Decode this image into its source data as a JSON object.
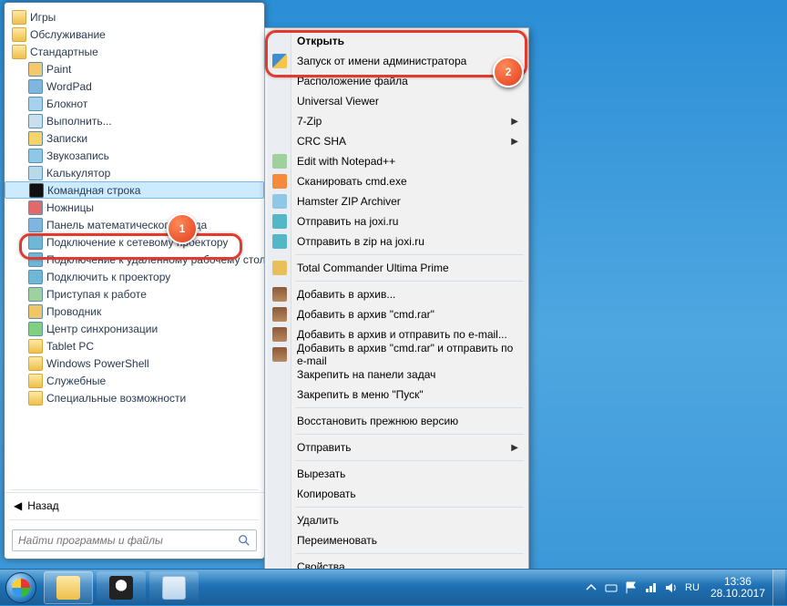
{
  "start_menu": {
    "items": [
      {
        "label": "Игры",
        "type": "folder",
        "indent": 0
      },
      {
        "label": "Обслуживание",
        "type": "folder",
        "indent": 0
      },
      {
        "label": "Стандартные",
        "type": "folder",
        "indent": 0,
        "expanded": true
      },
      {
        "label": "Paint",
        "type": "app",
        "indent": 1,
        "icon": "paint"
      },
      {
        "label": "WordPad",
        "type": "app",
        "indent": 1,
        "icon": "wordpad"
      },
      {
        "label": "Блокнот",
        "type": "app",
        "indent": 1,
        "icon": "notepad"
      },
      {
        "label": "Выполнить...",
        "type": "app",
        "indent": 1,
        "icon": "run"
      },
      {
        "label": "Записки",
        "type": "app",
        "indent": 1,
        "icon": "notes"
      },
      {
        "label": "Звукозапись",
        "type": "app",
        "indent": 1,
        "icon": "sound"
      },
      {
        "label": "Калькулятор",
        "type": "app",
        "indent": 1,
        "icon": "calc"
      },
      {
        "label": "Командная строка",
        "type": "app",
        "indent": 1,
        "icon": "cmd",
        "selected": true
      },
      {
        "label": "Ножницы",
        "type": "app",
        "indent": 1,
        "icon": "snip"
      },
      {
        "label": "Панель математического ввода",
        "type": "app",
        "indent": 1,
        "icon": "math"
      },
      {
        "label": "Подключение к сетевому проектору",
        "type": "app",
        "indent": 1,
        "icon": "netproj"
      },
      {
        "label": "Подключение к удаленному рабочему столу",
        "type": "app",
        "indent": 1,
        "icon": "rdp"
      },
      {
        "label": "Подключить к проектору",
        "type": "app",
        "indent": 1,
        "icon": "proj"
      },
      {
        "label": "Приступая к работе",
        "type": "app",
        "indent": 1,
        "icon": "welcome"
      },
      {
        "label": "Проводник",
        "type": "app",
        "indent": 1,
        "icon": "explorer"
      },
      {
        "label": "Центр синхронизации",
        "type": "app",
        "indent": 1,
        "icon": "sync"
      },
      {
        "label": "Tablet PC",
        "type": "folder",
        "indent": 1
      },
      {
        "label": "Windows PowerShell",
        "type": "folder",
        "indent": 1
      },
      {
        "label": "Служебные",
        "type": "folder",
        "indent": 1
      },
      {
        "label": "Специальные возможности",
        "type": "folder",
        "indent": 1
      }
    ],
    "back_label": "Назад",
    "search_placeholder": "Найти программы и файлы"
  },
  "context_menu": {
    "groups": [
      [
        {
          "label": "Открыть",
          "bold": true
        },
        {
          "label": "Запуск от имени администратора",
          "icon": "shield",
          "highlight": true
        },
        {
          "label": "Расположение файла"
        },
        {
          "label": "Universal Viewer"
        },
        {
          "label": "7-Zip",
          "submenu": true
        },
        {
          "label": "CRC SHA",
          "submenu": true
        },
        {
          "label": "Edit with Notepad++",
          "icon": "npp"
        },
        {
          "label": "Сканировать cmd.exe",
          "icon": "avast"
        },
        {
          "label": "Hamster ZIP Archiver",
          "icon": "hamster"
        },
        {
          "label": "Отправить на joxi.ru",
          "icon": "joxi"
        },
        {
          "label": "Отправить в zip на joxi.ru",
          "icon": "joxi"
        }
      ],
      [
        {
          "label": "Total Commander Ultima Prime",
          "icon": "tc"
        }
      ],
      [
        {
          "label": "Добавить в архив...",
          "icon": "rar"
        },
        {
          "label": "Добавить в архив \"cmd.rar\"",
          "icon": "rar"
        },
        {
          "label": "Добавить в архив и отправить по e-mail...",
          "icon": "rar"
        },
        {
          "label": "Добавить в архив \"cmd.rar\" и отправить по e-mail",
          "icon": "rar"
        },
        {
          "label": "Закрепить на панели задач"
        },
        {
          "label": "Закрепить в меню \"Пуск\""
        }
      ],
      [
        {
          "label": "Восстановить прежнюю версию"
        }
      ],
      [
        {
          "label": "Отправить",
          "submenu": true
        }
      ],
      [
        {
          "label": "Вырезать"
        },
        {
          "label": "Копировать"
        }
      ],
      [
        {
          "label": "Удалить"
        },
        {
          "label": "Переименовать"
        }
      ],
      [
        {
          "label": "Свойства"
        }
      ]
    ]
  },
  "taskbar": {
    "time": "13:36",
    "date": "28.10.2017",
    "lang": "RU"
  },
  "callouts": {
    "one": "1",
    "two": "2"
  }
}
